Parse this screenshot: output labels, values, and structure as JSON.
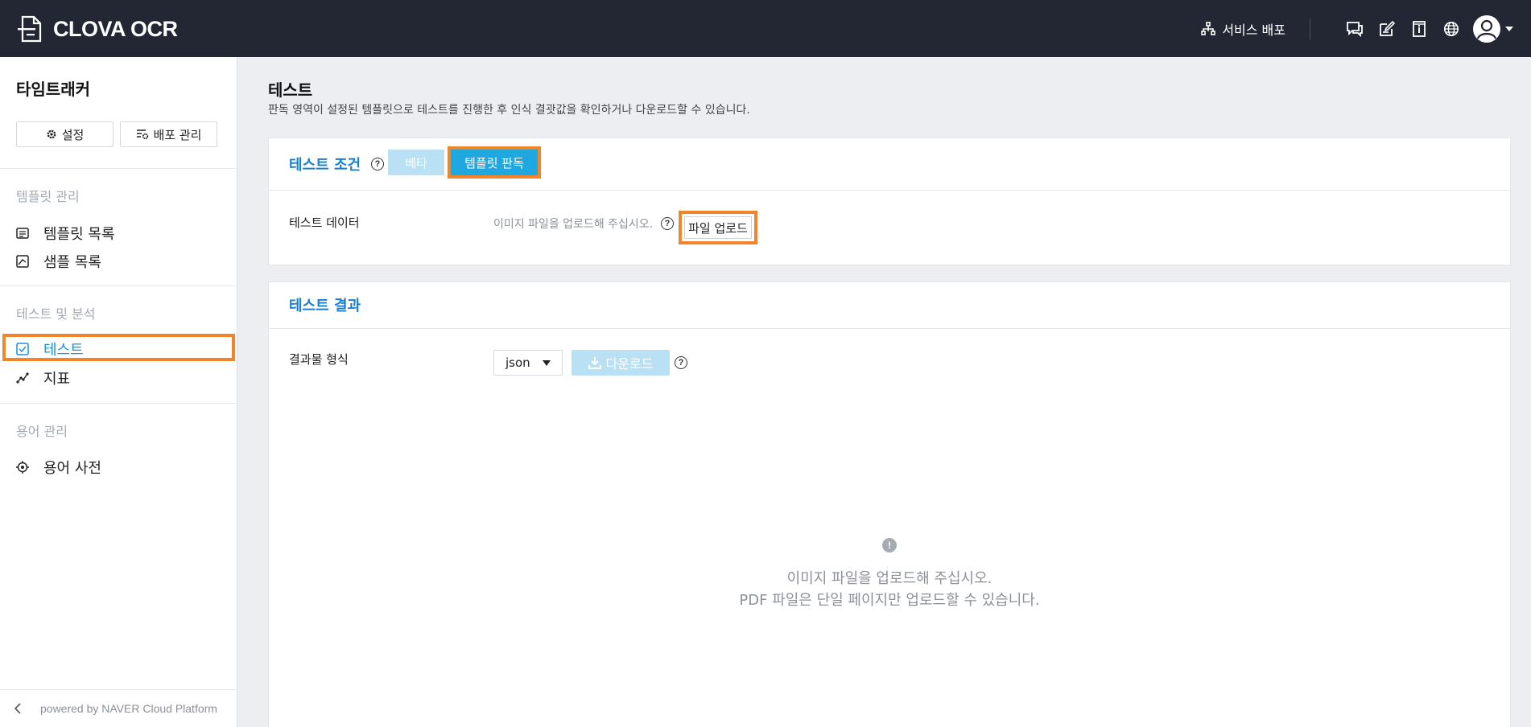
{
  "header": {
    "brand": "CLOVA OCR",
    "deploy_label": "서비스 배포",
    "icons": [
      "chat-icon",
      "edit-icon",
      "info-book-icon",
      "globe-icon",
      "user-avatar-icon"
    ]
  },
  "sidebar": {
    "project_title": "타임트래커",
    "settings_label": "설정",
    "deploy_manage_label": "배포 관리",
    "sections": [
      {
        "title": "템플릿 관리",
        "items": [
          {
            "label": "템플릿 목록"
          },
          {
            "label": "샘플 목록"
          }
        ]
      },
      {
        "title": "테스트 및 분석",
        "items": [
          {
            "label": "테스트"
          },
          {
            "label": "지표"
          }
        ]
      },
      {
        "title": "용어 관리",
        "items": [
          {
            "label": "용어 사전"
          }
        ]
      }
    ],
    "footer": "powered by NAVER Cloud Platform"
  },
  "main": {
    "title": "테스트",
    "description": "판독 영역이 설정된 템플릿으로 테스트를 진행한 후 인식 결괏값을 확인하거나 다운로드할 수 있습니다.",
    "conditions": {
      "title": "테스트 조건",
      "toggle_beta": "베타",
      "toggle_template": "템플릿 판독",
      "data_label": "테스트 데이터",
      "upload_hint": "이미지 파일을 업로드해 주십시오.",
      "upload_button": "파일 업로드"
    },
    "results": {
      "title": "테스트 결과",
      "format_label": "결과물 형식",
      "format_value": "json",
      "download_label": "다운로드",
      "empty_line1": "이미지 파일을 업로드해 주십시오.",
      "empty_line2": "PDF 파일은 단일 페이지만 업로드할 수 있습니다."
    }
  },
  "colors": {
    "topbar": "#232733",
    "accent": "#1a7fd0",
    "highlight": "#f0852b",
    "toggle_active": "#1fa8e0",
    "toggle_inactive": "#b9e1f3"
  }
}
